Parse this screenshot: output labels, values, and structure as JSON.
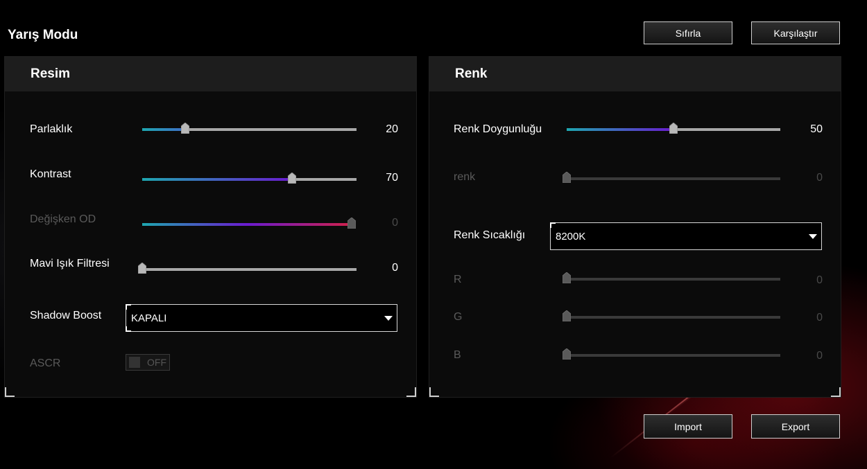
{
  "page": {
    "title": "Yarış Modu"
  },
  "buttons": {
    "reset": "Sıfırla",
    "compare": "Karşılaştır",
    "import": "Import",
    "export": "Export"
  },
  "picture": {
    "header": "Resim",
    "brightness": {
      "label": "Parlaklık",
      "value": 20,
      "max": 100,
      "enabled": true
    },
    "contrast": {
      "label": "Kontrast",
      "value": 70,
      "max": 100,
      "enabled": true
    },
    "variable_od": {
      "label": "Değişken OD",
      "value": 0,
      "max": 100,
      "enabled": false
    },
    "blue_light": {
      "label": "Mavi Işık Filtresi",
      "value": 0,
      "max": 100,
      "enabled": true
    },
    "shadow_boost": {
      "label": "Shadow Boost",
      "selected": "KAPALI"
    },
    "ascr": {
      "label": "ASCR",
      "state": "OFF",
      "enabled": false
    }
  },
  "color": {
    "header": "Renk",
    "saturation": {
      "label": "Renk Doygunluğu",
      "value": 50,
      "max": 100,
      "enabled": true
    },
    "hue": {
      "label": "renk",
      "value": 0,
      "max": 100,
      "enabled": false
    },
    "temperature": {
      "label": "Renk Sıcaklığı",
      "selected": "8200K"
    },
    "r": {
      "label": "R",
      "value": 0,
      "max": 100,
      "enabled": false
    },
    "g": {
      "label": "G",
      "value": 0,
      "max": 100,
      "enabled": false
    },
    "b": {
      "label": "B",
      "value": 0,
      "max": 100,
      "enabled": false
    }
  },
  "colors": {
    "accent_start": "#1ea7b0",
    "accent_mid": "#6a1bd0",
    "accent_end": "#d0204a",
    "thumb": "#b8b8b8"
  }
}
